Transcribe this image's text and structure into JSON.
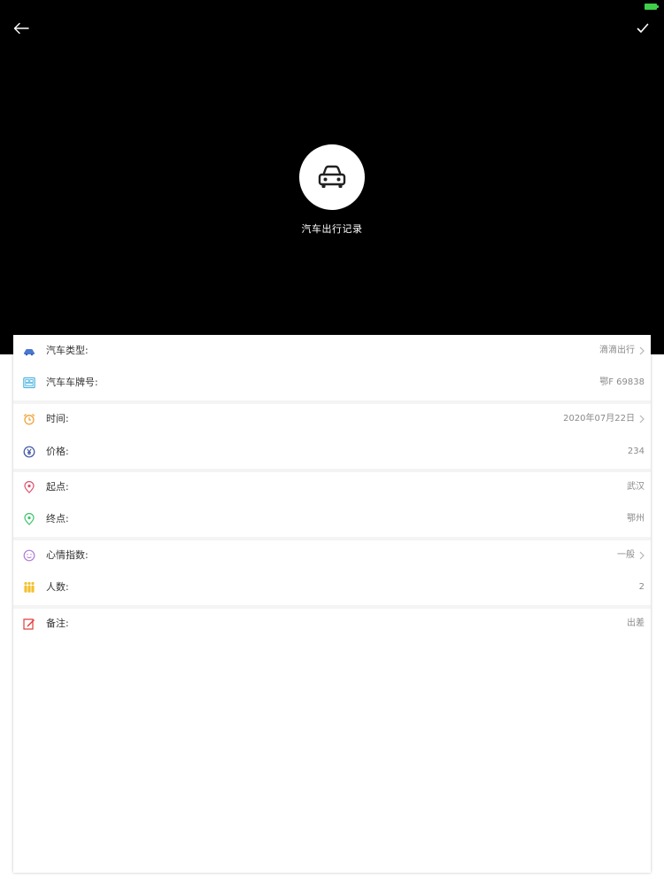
{
  "header": {
    "back_icon": "arrow-left-icon",
    "confirm_icon": "check-icon",
    "category_icon": "car-icon",
    "category_label": "汽车出行记录",
    "battery_color": "#3fcf4a"
  },
  "fields": [
    {
      "icon": "car-small-icon",
      "icon_color": "#4a78d0",
      "label": "汽车类型:",
      "value": "滴滴出行",
      "has_arrow": true
    },
    {
      "icon": "license-plate-icon",
      "icon_color": "#4fb3e0",
      "label": "汽车车牌号:",
      "value": "鄂F 69838",
      "has_arrow": false
    },
    {
      "icon": "alarm-clock-icon",
      "icon_color": "#f0a33a",
      "label": "时间:",
      "value": "2020年07月22日",
      "has_arrow": true
    },
    {
      "icon": "yen-icon",
      "icon_color": "#3b4fa0",
      "label": "价格:",
      "value": "234",
      "has_arrow": false
    },
    {
      "icon": "start-location-icon",
      "icon_color": "#e0506a",
      "label": "起点:",
      "value": "武汉",
      "has_arrow": false
    },
    {
      "icon": "end-location-icon",
      "icon_color": "#3cc46a",
      "label": "终点:",
      "value": "鄂州",
      "has_arrow": false
    },
    {
      "icon": "smiley-icon",
      "icon_color": "#b07ad8",
      "label": "心情指数:",
      "value": "一般",
      "has_arrow": true
    },
    {
      "icon": "people-icon",
      "icon_color": "#f2c12e",
      "label": "人数:",
      "value": "2",
      "has_arrow": false
    },
    {
      "icon": "note-edit-icon",
      "icon_color": "#e23a3a",
      "label": "备注:",
      "value": "出差",
      "has_arrow": false
    }
  ]
}
